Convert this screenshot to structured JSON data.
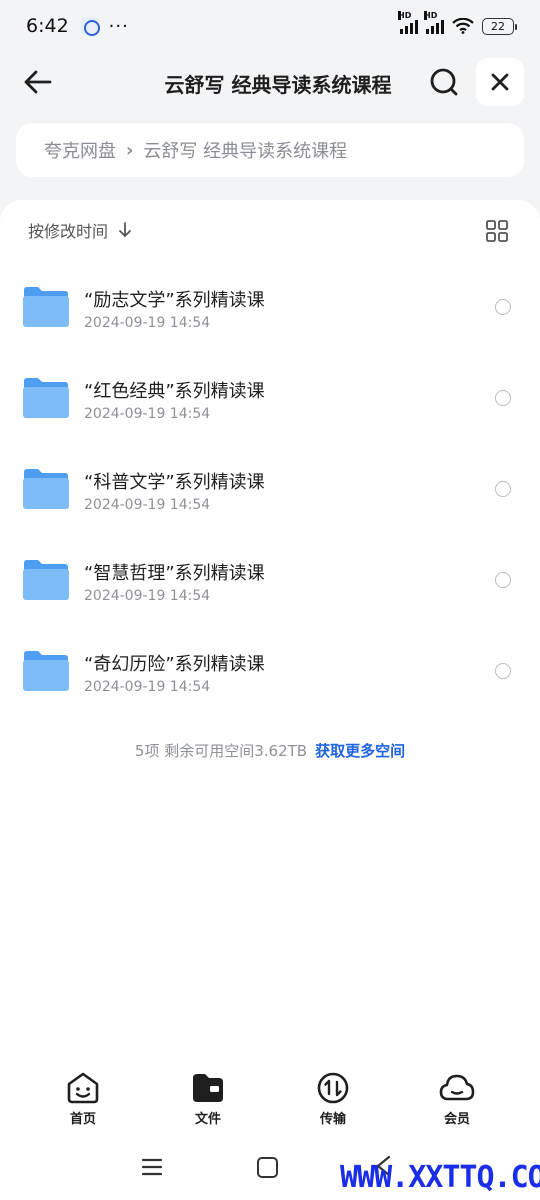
{
  "status_bar": {
    "time": "6:42",
    "more": "···",
    "signal1_label": "HD",
    "signal2_label": "HD",
    "battery": "22"
  },
  "header": {
    "title": "云舒写 经典导读系统课程",
    "back_icon": "arrow-left-icon",
    "search_icon": "search-icon",
    "close_icon": "close-icon"
  },
  "breadcrumb": {
    "root": "夸克网盘",
    "separator": "›",
    "current": "云舒写 经典导读系统课程"
  },
  "sort": {
    "label": "按修改时间",
    "direction_icon": "arrow-down-icon",
    "view_icon": "grid-view-icon"
  },
  "files": [
    {
      "name": "“励志文学”系列精读课",
      "date": "2024-09-19 14:54"
    },
    {
      "name": "“红色经典”系列精读课",
      "date": "2024-09-19 14:54"
    },
    {
      "name": "“科普文学”系列精读课",
      "date": "2024-09-19 14:54"
    },
    {
      "name": "“智慧哲理”系列精读课",
      "date": "2024-09-19 14:54"
    },
    {
      "name": "“奇幻历险”系列精读课",
      "date": "2024-09-19 14:54"
    }
  ],
  "footer": {
    "summary": "5项 剩余可用空间3.62TB",
    "link": "获取更多空间"
  },
  "tabbar": {
    "items": [
      {
        "label": "首页",
        "icon": "home-smile-icon"
      },
      {
        "label": "文件",
        "icon": "folder-icon"
      },
      {
        "label": "传输",
        "icon": "transfer-icon"
      },
      {
        "label": "会员",
        "icon": "cloud-icon"
      }
    ]
  },
  "watermark": "WWW.XXTTQ.COM",
  "colors": {
    "accent": "#1f64e0",
    "folder": "#6fb3f5",
    "background": "#f3f4f6"
  }
}
